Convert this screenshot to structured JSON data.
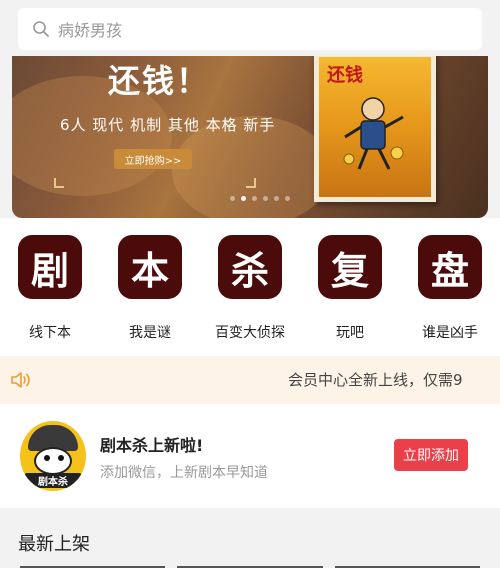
{
  "search": {
    "placeholder": "病娇男孩"
  },
  "banner": {
    "title": "还钱！",
    "tags": "6人 现代 机制 其他 本格 新手",
    "button_label": "立即抢购>>",
    "poster_title": "还钱",
    "slide_count": 6,
    "active_slide": 1
  },
  "categories": [
    {
      "glyph": "剧",
      "label": "线下本",
      "icon": "ju-glyph-icon"
    },
    {
      "glyph": "本",
      "label": "我是谜",
      "icon": "ben-glyph-icon"
    },
    {
      "glyph": "杀",
      "label": "百变大侦探",
      "icon": "sha-glyph-icon"
    },
    {
      "glyph": "复",
      "label": "玩吧",
      "icon": "fu-glyph-icon"
    },
    {
      "glyph": "盘",
      "label": "谁是凶手",
      "icon": "pan-glyph-icon"
    }
  ],
  "notice": {
    "text": "会员中心全新上线，仅需9",
    "icon": "speaker-icon"
  },
  "promo": {
    "avatar_text": "剧本杀",
    "title": "剧本杀上新啦!",
    "subtitle": "添加微信，上新剧本早知道",
    "button_label": "立即添加"
  },
  "latest": {
    "title": "最新上架"
  },
  "colors": {
    "accent_red": "#e9404a",
    "category_bg": "#4b0b0b",
    "notice_bg": "#fdf3e6",
    "banner_button": "#c98a3a"
  }
}
